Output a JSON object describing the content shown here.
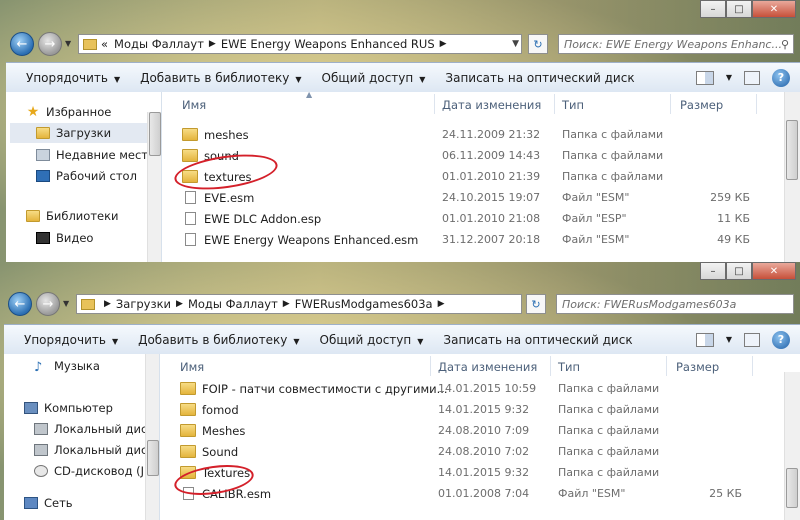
{
  "window1": {
    "address": {
      "crumbs": [
        "«",
        "Моды Фаллаут",
        "EWE Energy Weapons Enhanced RUS"
      ]
    },
    "search_placeholder": "Поиск: EWE Energy Weapons Enhanc...",
    "toolbar": {
      "organize": "Упорядочить",
      "library": "Добавить в библиотеку",
      "share": "Общий доступ",
      "burn": "Записать на оптический диск"
    },
    "sidebar": [
      {
        "label": "Избранное",
        "icon": "star-icon"
      },
      {
        "label": "Загрузки",
        "icon": "downloads-folder-icon",
        "selected": true
      },
      {
        "label": "Недавние места",
        "icon": "recent-places-icon"
      },
      {
        "label": "Рабочий стол",
        "icon": "desktop-icon"
      },
      {
        "label": "Библиотеки",
        "icon": "libraries-icon"
      },
      {
        "label": "Видео",
        "icon": "video-icon"
      }
    ],
    "columns": {
      "name": "Имя",
      "date": "Дата изменения",
      "type": "Тип",
      "size": "Размер"
    },
    "files": [
      {
        "name": "meshes",
        "date": "24.11.2009 21:32",
        "type": "Папка с файлами",
        "size": "",
        "kind": "folder"
      },
      {
        "name": "sound",
        "date": "06.11.2009 14:43",
        "type": "Папка с файлами",
        "size": "",
        "kind": "folder"
      },
      {
        "name": "textures",
        "date": "01.01.2010 21:39",
        "type": "Папка с файлами",
        "size": "",
        "kind": "folder"
      },
      {
        "name": "EVE.esm",
        "date": "24.10.2015 19:07",
        "type": "Файл \"ESM\"",
        "size": "259 КБ",
        "kind": "file"
      },
      {
        "name": "EWE DLC Addon.esp",
        "date": "01.01.2010 21:08",
        "type": "Файл \"ESP\"",
        "size": "11 КБ",
        "kind": "file"
      },
      {
        "name": "EWE Energy Weapons Enhanced.esm",
        "date": "31.12.2007 20:18",
        "type": "Файл \"ESM\"",
        "size": "49 КБ",
        "kind": "file"
      }
    ]
  },
  "window2": {
    "address": {
      "crumbs": [
        "Загрузки",
        "Моды Фаллаут",
        "FWERusModgames603a"
      ]
    },
    "search_placeholder": "Поиск: FWERusModgames603a",
    "toolbar": {
      "organize": "Упорядочить",
      "library": "Добавить в библиотеку",
      "share": "Общий доступ",
      "burn": "Записать на оптический диск"
    },
    "sidebar": [
      {
        "label": "Музыка",
        "icon": "music-icon"
      },
      {
        "label": "Компьютер",
        "icon": "computer-icon"
      },
      {
        "label": "Локальный диск",
        "icon": "local-disk-icon"
      },
      {
        "label": "Локальный диск",
        "icon": "local-disk-icon"
      },
      {
        "label": "CD-дисковод (J:)",
        "icon": "cd-drive-icon"
      },
      {
        "label": "Сеть",
        "icon": "network-icon"
      }
    ],
    "columns": {
      "name": "Имя",
      "date": "Дата изменения",
      "type": "Тип",
      "size": "Размер"
    },
    "files": [
      {
        "name": "FOIP - патчи совместимости с другими...",
        "date": "14.01.2015 10:59",
        "type": "Папка с файлами",
        "size": "",
        "kind": "folder"
      },
      {
        "name": "fomod",
        "date": "14.01.2015 9:32",
        "type": "Папка с файлами",
        "size": "",
        "kind": "folder"
      },
      {
        "name": "Meshes",
        "date": "24.08.2010 7:09",
        "type": "Папка с файлами",
        "size": "",
        "kind": "folder"
      },
      {
        "name": "Sound",
        "date": "24.08.2010 7:02",
        "type": "Папка с файлами",
        "size": "",
        "kind": "folder"
      },
      {
        "name": "Textures",
        "date": "14.01.2015 9:32",
        "type": "Папка с файлами",
        "size": "",
        "kind": "folder"
      },
      {
        "name": "CALIBR.esm",
        "date": "01.01.2008 7:04",
        "type": "Файл \"ESM\"",
        "size": "25 КБ",
        "kind": "file"
      }
    ]
  },
  "colors": {
    "accent": "#2b6fb3",
    "highlight_circle": "#d4202a",
    "selection": "#e3e9f2"
  }
}
